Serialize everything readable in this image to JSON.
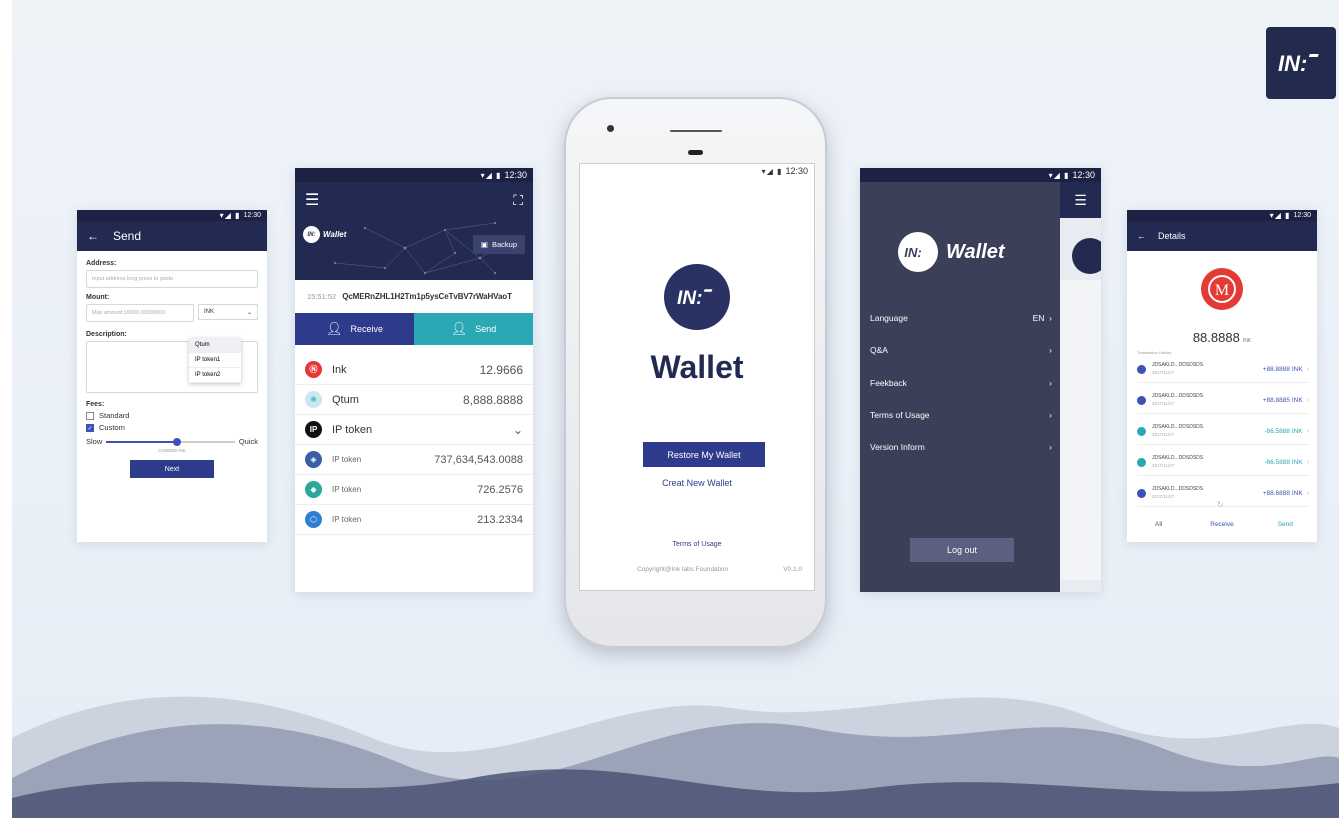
{
  "corner_logo": {
    "icon": "ink-logo-icon"
  },
  "colors": {
    "navy": "#232a52",
    "accent_blue": "#2e3a8c",
    "teal": "#2aa8b4",
    "ink_red": "#e53935",
    "positive": "#3f51b5",
    "negative": "#2aa8b4"
  },
  "status": {
    "time": "12:30"
  },
  "send_screen": {
    "title": "Send",
    "address_label": "Address:",
    "address_placeholder": "Input address,long press to paste",
    "mount_label": "Mount:",
    "mount_placeholder": "Max amount:10000.00000000",
    "token_select": "INK",
    "dropdown_options": [
      "Qtum",
      "IP token1",
      "IP token2"
    ],
    "description_label": "Description:",
    "fees_label": "Fees:",
    "fee_options": [
      {
        "label": "Standard",
        "checked": false
      },
      {
        "label": "Custom",
        "checked": true
      }
    ],
    "slider_left": "Slow",
    "slider_right": "Quick",
    "slider_value_text": "0.000056 INK",
    "slider_fraction": 0.55,
    "next_button": "Next"
  },
  "wallet_screen": {
    "brand": "Wallet",
    "backup_button": "Backup",
    "address_prefix": "15:51:52",
    "address": "QcMERnZHL1H2Tm1p5ysCeTvBV7rWaHVaoT",
    "receive_button": "Receive",
    "send_button": "Send",
    "tokens": [
      {
        "name": "Ink",
        "value": "12.9666",
        "icon": "ink-token-icon"
      },
      {
        "name": "Qtum",
        "value": "8,888.8888",
        "icon": "qtum-token-icon"
      },
      {
        "name": "IP token",
        "value": "",
        "icon": "ip-token-icon"
      },
      {
        "name": "IP token",
        "value": "737,634,543.0088",
        "icon": "shield-token-icon"
      },
      {
        "name": "IP token",
        "value": "726.2576",
        "icon": "diamond-token-icon"
      },
      {
        "name": "IP token",
        "value": "213.2334",
        "icon": "hex-token-icon"
      }
    ]
  },
  "main_screen": {
    "title": "Wallet",
    "restore_button": "Restore My Wallet",
    "create_link": "Creat New Wallet",
    "terms_link": "Terms of Usage",
    "copyright": "Copyright@Ink labs Foundation",
    "version": "V0.1.0"
  },
  "menu_screen": {
    "brand": "Wallet",
    "items": [
      {
        "label": "Language",
        "value": "EN"
      },
      {
        "label": "Q&A",
        "value": ""
      },
      {
        "label": "Feekback",
        "value": ""
      },
      {
        "label": "Terms of Usage",
        "value": ""
      },
      {
        "label": "Version Inform",
        "value": ""
      }
    ],
    "logout_button": "Log out"
  },
  "details_screen": {
    "title": "Details",
    "amount": "88.8888",
    "unit": "INK",
    "history_label": "Transaction History",
    "transactions": [
      {
        "address": "JDSAKLD...DDSDSDS",
        "date": "2017/11/27",
        "amount": "+88.8888 INK",
        "direction": "in"
      },
      {
        "address": "JDSAKLD...DDSDSDS",
        "date": "2017/11/27",
        "amount": "+88.8885 INK",
        "direction": "in"
      },
      {
        "address": "JDSAKLD...DDSDSDS",
        "date": "2017/11/27",
        "amount": "-66.5888 INK",
        "direction": "out"
      },
      {
        "address": "JDSAKLD...DDSDSDS",
        "date": "2017/11/27",
        "amount": "-66.5888 INK",
        "direction": "out"
      },
      {
        "address": "JDSAKLD...DDSDSDS",
        "date": "2017/11/27",
        "amount": "+88.6888 INK",
        "direction": "in"
      }
    ],
    "tabs": [
      "All",
      "Receive",
      "Send"
    ]
  }
}
